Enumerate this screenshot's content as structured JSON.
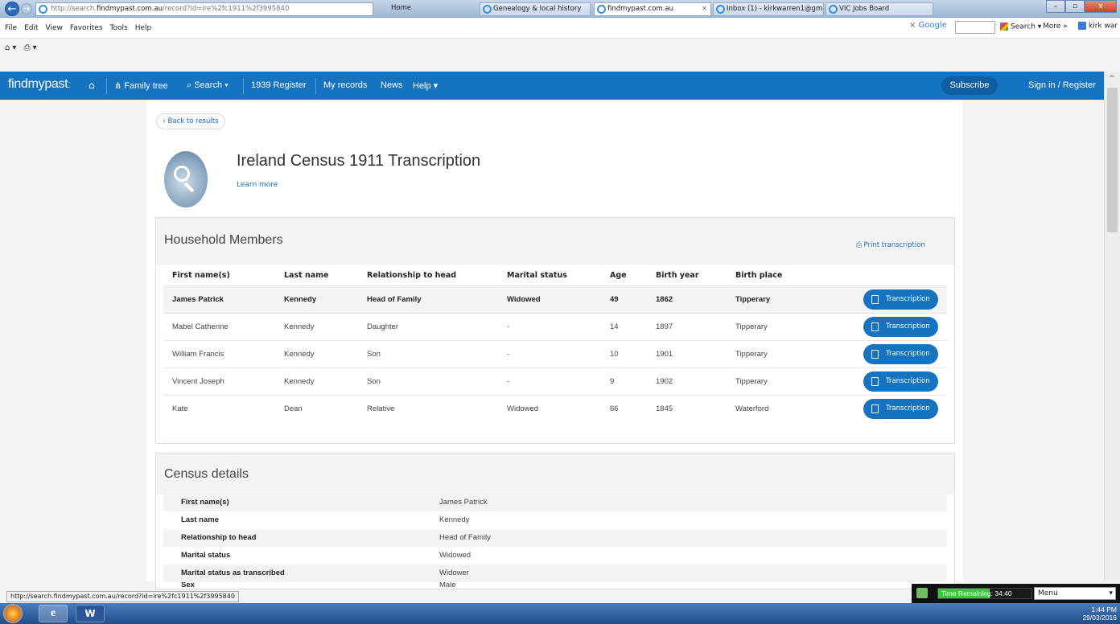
{
  "browser": {
    "url_prefix": "http://search.",
    "url_domain": "findmypast.com.au",
    "url_path": "/record?id=ire%2fc1911%2f3995840",
    "address_icons": "⌕ ▾ ↻",
    "tabs": [
      {
        "label": "Home"
      },
      {
        "label": "Genealogy & local history"
      },
      {
        "label": "findmypast.com.au"
      },
      {
        "label": "Inbox (1) - kirkwarren1@gmail..."
      },
      {
        "label": "VIC Jobs Board"
      }
    ],
    "menus": [
      "File",
      "Edit",
      "View",
      "Favorites",
      "Tools",
      "Help"
    ],
    "google_label": "Google",
    "search_label": "Search",
    "more_label": "More",
    "user_label": "kirk war"
  },
  "site": {
    "logo_text": "findmypast",
    "nav": [
      "Family tree",
      "Search",
      "1939 Register",
      "My records",
      "News",
      "Help"
    ],
    "subscribe_label": "Subscribe",
    "signin_label": "Sign in / Register"
  },
  "page": {
    "back_label": "‹ Back to results",
    "title": "Ireland Census 1911 Transcription",
    "learn_more": "Learn more"
  },
  "household": {
    "title": "Household Members",
    "print_label": "Print transcription",
    "headers": [
      "First name(s)",
      "Last name",
      "Relationship to head",
      "Marital status",
      "Age",
      "Birth year",
      "Birth place"
    ],
    "button_label": "Transcription",
    "rows": [
      [
        "James Patrick",
        "Kennedy",
        "Head of Family",
        "Widowed",
        "49",
        "1862",
        "Tipperary"
      ],
      [
        "Mabel Catherine",
        "Kennedy",
        "Daughter",
        "-",
        "14",
        "1897",
        "Tipperary"
      ],
      [
        "William Francis",
        "Kennedy",
        "Son",
        "-",
        "10",
        "1901",
        "Tipperary"
      ],
      [
        "Vincent Joseph",
        "Kennedy",
        "Son",
        "-",
        "9",
        "1902",
        "Tipperary"
      ],
      [
        "Kate",
        "Dean",
        "Relative",
        "Widowed",
        "66",
        "1845",
        "Waterford"
      ]
    ]
  },
  "census": {
    "title": "Census details",
    "rows": [
      [
        "First name(s)",
        "James Patrick"
      ],
      [
        "Last name",
        "Kennedy"
      ],
      [
        "Relationship to head",
        "Head of Family"
      ],
      [
        "Marital status",
        "Widowed"
      ],
      [
        "Marital status as transcribed",
        "Widower"
      ],
      [
        "Sex",
        "Male"
      ]
    ]
  },
  "status_url": "http://search.findmypast.com.au/record?id=ire%2fc1911%2f3995840",
  "timer": {
    "label": "Time Remaining: 34:40",
    "menu": "Menu",
    "fraction_remaining": 0.55
  },
  "clock": {
    "time": "1:44 PM",
    "date": "29/03/2016"
  },
  "colors": {
    "brand": "#1573c0",
    "accent_green": "#9be15d"
  }
}
